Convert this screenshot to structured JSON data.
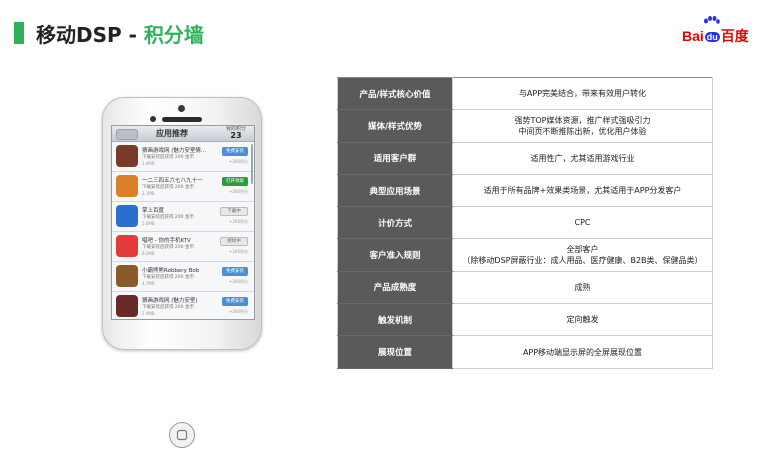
{
  "header": {
    "title_main": "移动DSP - ",
    "title_accent": "积分墙",
    "colors": {
      "accent": "#2eb35a",
      "label_bg": "#5a5a5a"
    }
  },
  "logo": {
    "bai": "Bai",
    "du": "du",
    "cn": "百度"
  },
  "phone": {
    "screen_title": "应用推荐",
    "score_label": "我的积分",
    "score_value": "23",
    "apps": [
      {
        "name": "猜画游戏网 (魅力安室情…",
        "desc": "下载安装后获得 200 金币",
        "size": "2.4MB",
        "button": "免费安装",
        "style": "blue",
        "points": "+200积分",
        "icon_color": "#7a3a2a"
      },
      {
        "name": "一二三四五六七八九十一",
        "desc": "下载安装后获得 200 金币",
        "size": "3.1MB",
        "button": "打开领取",
        "style": "green",
        "points": "+200积分",
        "icon_color": "#d9822b"
      },
      {
        "name": "掌上百度",
        "desc": "下载安装后获得 200 金币",
        "size": "5.6MB",
        "button": "下载中",
        "style": "gray",
        "points": "+200积分",
        "icon_color": "#2a6fd0"
      },
      {
        "name": "唱吧 - 你的手机KTV",
        "desc": "下载安装后获得 200 金币",
        "size": "8.2MB",
        "button": "继续中",
        "style": "gray",
        "points": "+200积分",
        "icon_color": "#e23b3b"
      },
      {
        "name": "小霸熊熊Robbery Bob",
        "desc": "下载安装后获得 200 金币",
        "size": "4.7MB",
        "button": "免费安装",
        "style": "blue",
        "points": "+200积分",
        "icon_color": "#8a5a2a"
      },
      {
        "name": "猜画游戏网 (魅力安室)",
        "desc": "下载安装后获得 200 金币",
        "size": "2.4MB",
        "button": "免费安装",
        "style": "blue",
        "points": "+200积分",
        "icon_color": "#6a2a2a"
      }
    ]
  },
  "table": {
    "rows": [
      {
        "label": "产品/样式核心价值",
        "value": [
          "与APP完美结合，带来有效用户转化"
        ]
      },
      {
        "label": "媒体/样式优势",
        "value": [
          "强势TOP媒体资源，推广样式强吸引力",
          "中间页不断推陈出新，优化用户体验"
        ]
      },
      {
        "label": "适用客户群",
        "value": [
          "适用性广，尤其适用游戏行业"
        ]
      },
      {
        "label": "典型应用场景",
        "value": [
          "适用于所有品牌+效果类场景，尤其适用于APP分发客户"
        ]
      },
      {
        "label": "计价方式",
        "value": [
          "CPC"
        ]
      },
      {
        "label": "客户准入规则",
        "value": [
          "全部客户",
          "（除移动DSP屏蔽行业：成人用品、医疗健康、B2B类、保健品类）"
        ]
      },
      {
        "label": "产品成熟度",
        "value": [
          "成熟"
        ]
      },
      {
        "label": "触发机制",
        "value": [
          "定向触发"
        ]
      },
      {
        "label": "展现位置",
        "value": [
          "APP移动端显示屏的全屏展现位置"
        ]
      }
    ]
  }
}
